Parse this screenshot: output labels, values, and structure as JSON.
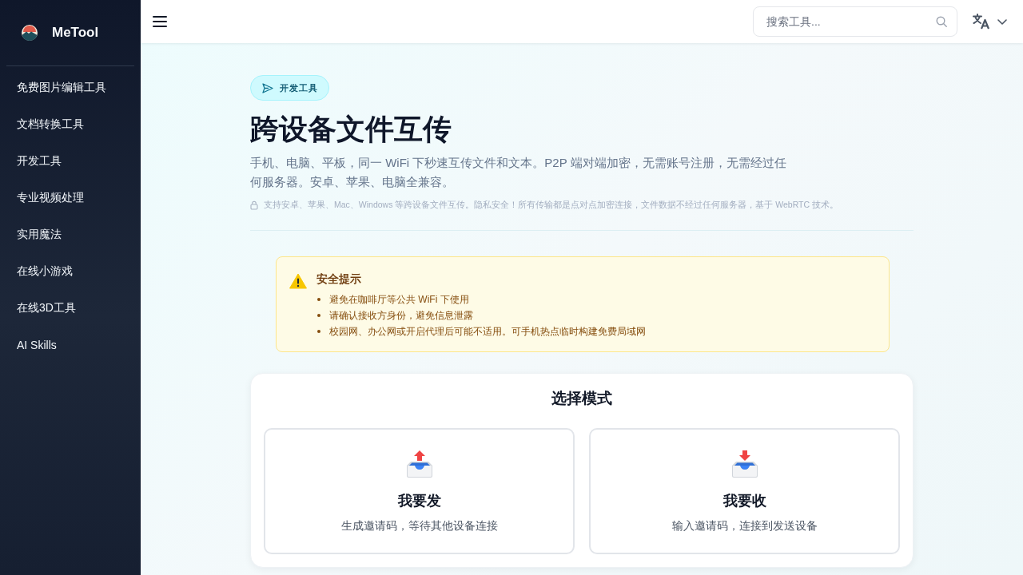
{
  "sidebar": {
    "logo_text": "MeTool",
    "items": [
      {
        "label": "免费图片编辑工具"
      },
      {
        "label": "文档转换工具"
      },
      {
        "label": "开发工具"
      },
      {
        "label": "专业视频处理"
      },
      {
        "label": "实用魔法"
      },
      {
        "label": "在线小游戏"
      },
      {
        "label": "在线3D工具"
      },
      {
        "label": "AI Skills"
      }
    ]
  },
  "header": {
    "search": {
      "placeholder": "搜索工具..."
    }
  },
  "badge": {
    "label": "开发工具"
  },
  "title": "跨设备文件互传",
  "description": "手机、电脑、平板，同一 WiFi 下秒速互传文件和文本。P2P 端对端加密，无需账号注册，无需经过任何服务器。安卓、苹果、电脑全兼容。",
  "note": "支持安卓、苹果、Mac、Windows 等跨设备文件互传。隐私安全！所有传输都是点对点加密连接，文件数据不经过任何服务器，基于 WebRTC 技术。",
  "warning": {
    "title": "安全提示",
    "items": [
      "避免在咖啡厅等公共 WiFi 下使用",
      "请确认接收方身份，避免信息泄露",
      "校园网、办公网或开启代理后可能不适用。可手机热点临时构建免费局域网"
    ]
  },
  "mode_panel": {
    "title": "选择模式",
    "options": [
      {
        "kind": "send",
        "title": "我要发",
        "description": "生成邀请码，等待其他设备连接"
      },
      {
        "kind": "receive",
        "title": "我要收",
        "description": "输入邀请码，连接到发送设备"
      }
    ]
  }
}
